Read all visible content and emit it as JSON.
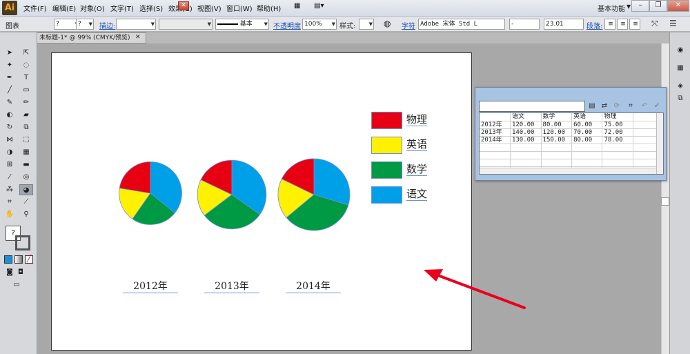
{
  "app": {
    "logo": "Ai"
  },
  "menu": [
    "文件(F)",
    "编辑(E)",
    "对象(O)",
    "文字(T)",
    "选择(S)",
    "效果(C)",
    "视图(V)",
    "窗口(W)",
    "帮助(H)"
  ],
  "workspace": {
    "label": "基本功能"
  },
  "controlbar": {
    "object_type": "图表",
    "fill_value": "?",
    "stroke_value": "?",
    "stroke_label": "描边:",
    "stroke_profile": "基本",
    "opacity_label": "不透明度",
    "opacity_value": "100%",
    "style_label": "样式:",
    "char_label": "字符",
    "font_name": "Adobe 宋体 Std L",
    "font_style": "-",
    "font_size": "23.01",
    "para_label": "段落:"
  },
  "document": {
    "tab_title": "未标题-1* @ 99% (CMYK/预览)"
  },
  "legend": [
    {
      "label": "物理",
      "color": "#e60012"
    },
    {
      "label": "英语",
      "color": "#fff100"
    },
    {
      "label": "数学",
      "color": "#009944"
    },
    {
      "label": "语文",
      "color": "#00a0e9"
    }
  ],
  "chart_data": {
    "type": "pie",
    "categories": [
      "2012年",
      "2013年",
      "2014年"
    ],
    "series": [
      {
        "name": "语文",
        "values": [
          120.0,
          140.0,
          130.0
        ],
        "color": "#00a0e9"
      },
      {
        "name": "数学",
        "values": [
          80.0,
          120.0,
          150.0
        ],
        "color": "#009944"
      },
      {
        "name": "英语",
        "values": [
          60.0,
          70.0,
          80.0
        ],
        "color": "#fff100"
      },
      {
        "name": "物理",
        "values": [
          75.0,
          72.0,
          78.0
        ],
        "color": "#e60012"
      }
    ]
  },
  "data_grid": {
    "headers": [
      "",
      "语文",
      "数学",
      "英语",
      "物理",
      ""
    ],
    "rows": [
      [
        "2012年",
        "120.00",
        "80.00",
        "60.00",
        "75.00",
        ""
      ],
      [
        "2013年",
        "140.00",
        "120.00",
        "70.00",
        "72.00",
        ""
      ],
      [
        "2014年",
        "130.00",
        "150.00",
        "80.00",
        "78.00",
        ""
      ],
      [
        "",
        "",
        "",
        "",
        "",
        ""
      ],
      [
        "",
        "",
        "",
        "",
        "",
        ""
      ],
      [
        "",
        "",
        "",
        "",
        "",
        ""
      ],
      [
        "",
        "",
        "",
        "",
        "",
        ""
      ]
    ]
  },
  "colors": {
    "annotation_arrow": "#e8001c"
  }
}
